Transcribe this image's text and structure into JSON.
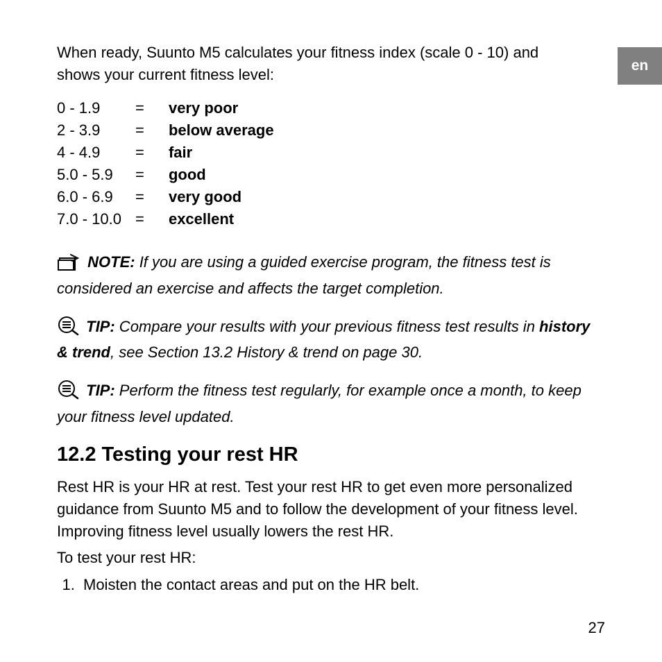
{
  "lang_tab": "en",
  "intro": "When ready, Suunto M5 calculates your fitness index (scale 0 - 10) and shows your current fitness level:",
  "scale": [
    {
      "range": "0 - 1.9",
      "eq": "=",
      "label": "very poor"
    },
    {
      "range": "2 - 3.9",
      "eq": "=",
      "label": "below average"
    },
    {
      "range": "4 - 4.9",
      "eq": "=",
      "label": "fair"
    },
    {
      "range": "5.0 - 5.9",
      "eq": "=",
      "label": "good"
    },
    {
      "range": "6.0 - 6.9",
      "eq": "=",
      "label": "very good"
    },
    {
      "range": "7.0 - 10.0",
      "eq": "=",
      "label": "excellent"
    }
  ],
  "note": {
    "lead": "NOTE:",
    "text": " If you are using a guided exercise program, the fitness test is considered an exercise and affects the target completion."
  },
  "tip1": {
    "lead": "TIP:",
    "pre": " Compare your results with your previous fitness test results in ",
    "bold": "history & trend",
    "post": ", see Section 13.2 History & trend on page 30."
  },
  "tip2": {
    "lead": "TIP:",
    "text": " Perform the fitness test regularly, for example once a month, to keep your fitness level updated."
  },
  "section_heading": "12.2  Testing your rest HR",
  "body1": "Rest HR is your HR at rest. Test your rest HR to get even more personalized guidance from Suunto M5 and to follow the development of your fitness level. Improving fitness level usually lowers the rest HR.",
  "body2": "To test your rest HR:",
  "steps": [
    "Moisten the contact areas and put on the HR belt."
  ],
  "page_number": "27"
}
